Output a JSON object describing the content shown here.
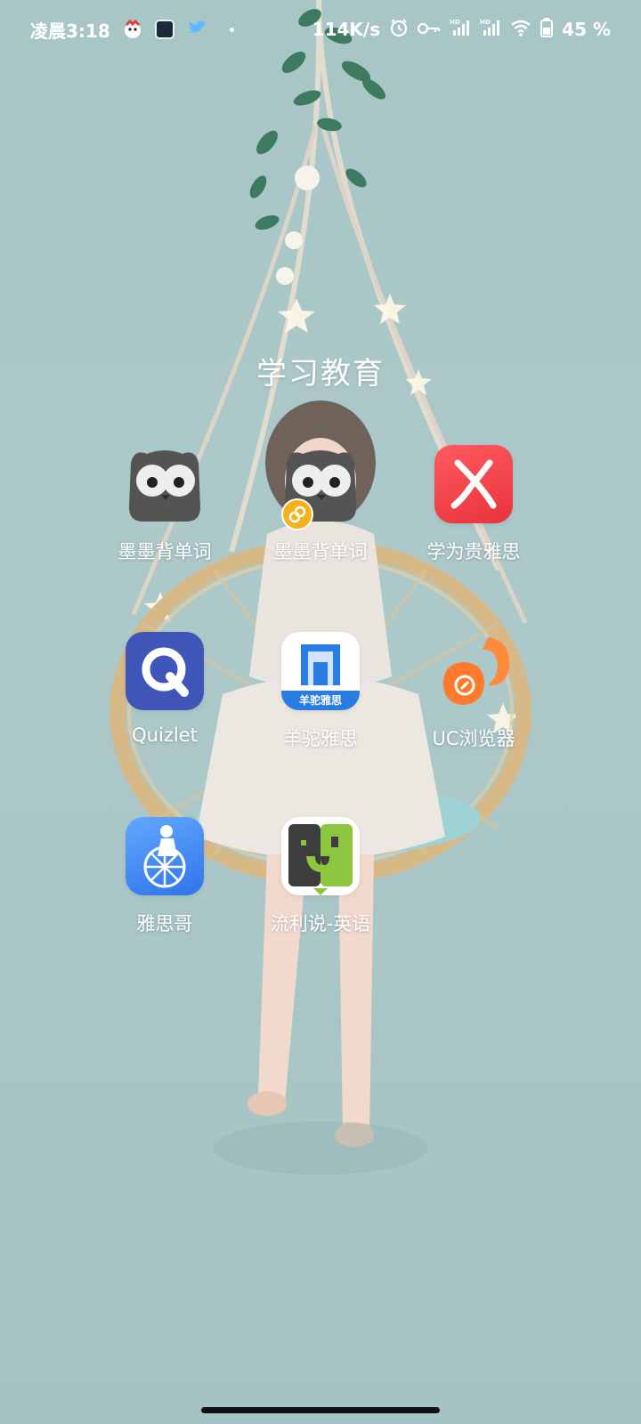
{
  "status_bar": {
    "time": "凌晨3:18",
    "network_speed": "114K/s",
    "battery_percent": "45 %",
    "left_icons": [
      "red-character-notification-icon",
      "tablet-notification-icon",
      "bird-notification-icon",
      "more-dot-icon"
    ],
    "right_icons": [
      "alarm-icon",
      "key-icon",
      "hd-signal-icon",
      "hd-signal-icon-2",
      "wifi-icon",
      "battery-icon"
    ]
  },
  "folder": {
    "title": "学习教育",
    "apps": [
      {
        "label": "墨墨背单词",
        "icon": "owl-icon"
      },
      {
        "label": "墨墨背单词",
        "icon": "owl-icon",
        "badge": "clone-badge"
      },
      {
        "label": "学为贵雅思",
        "icon": "x-app-icon",
        "color": "#ef3e47"
      },
      {
        "label": "Quizlet",
        "icon": "quizlet-icon",
        "color": "#3f55b8"
      },
      {
        "label": "羊驼雅思",
        "icon": "alpaca-icon",
        "banner": "羊驼雅思",
        "color": "#2a7de0"
      },
      {
        "label": "UC浏览器",
        "icon": "squirrel-icon",
        "color": "#ff7a2b"
      },
      {
        "label": "雅思哥",
        "icon": "ielts-bro-icon",
        "color": "#3f86f0"
      },
      {
        "label": "流利说-英语",
        "icon": "liulishuo-icon",
        "color": "#8cc63e"
      }
    ]
  }
}
